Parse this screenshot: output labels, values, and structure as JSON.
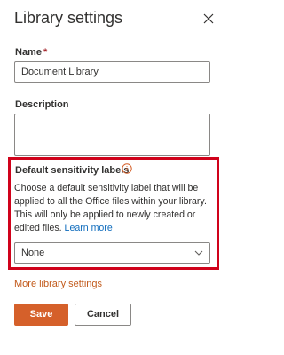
{
  "panel": {
    "title": "Library settings",
    "close_icon": "close-icon"
  },
  "name": {
    "label": "Name",
    "required_marker": "*",
    "value": "Document Library"
  },
  "description": {
    "label": "Description",
    "value": ""
  },
  "sensitivity": {
    "label": "Default sensitivity labels",
    "info_icon": "info-icon",
    "description": "Choose a default sensitivity label that will be applied to all the Office files within your library. This will only be applied to newly created or edited files.",
    "learn_more": "Learn more",
    "dropdown_value": "None",
    "highlight_color": "#d0021b"
  },
  "links": {
    "more_settings": "More library settings"
  },
  "buttons": {
    "save": "Save",
    "cancel": "Cancel"
  },
  "colors": {
    "accent": "#d5602a",
    "link": "#0f6cbd",
    "required": "#a4262c"
  }
}
